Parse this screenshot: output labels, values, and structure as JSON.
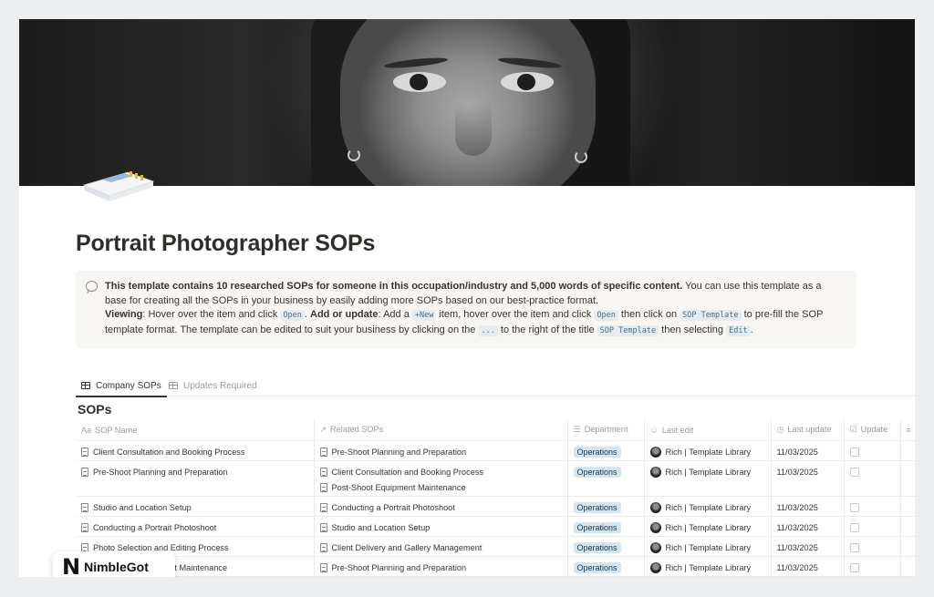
{
  "page": {
    "title": "Portrait Photographer SOPs"
  },
  "callout": {
    "bold_intro": "This template contains 10 researched SOPs for someone in this occupation/industry and 5,000 words of specific content.",
    "intro_rest": " You can use this template as a base for creating all the SOPs in your business by easily adding more SOPs based on our best-practice format.",
    "viewing_label": "Viewing",
    "viewing_text": ": Hover over the item and click ",
    "open_code": "Open",
    "period_sep": ". ",
    "add_label": "Add or update",
    "add_text_1": ": Add a ",
    "new_code": "+New",
    "add_text_2": " item, hover over the item and click ",
    "open_code_2": "Open",
    "add_text_3": " then click on ",
    "sop_template_code": "SOP Template",
    "add_text_4": " to pre-fill the SOP template format. The template can be edited to suit your business by clicking on the ",
    "dots_code": "...",
    "add_text_5": " to the right of the title ",
    "sop_template_code_2": "SOP Template",
    "add_text_6": " then selecting ",
    "edit_code": "Edit",
    "end": "."
  },
  "tabs": [
    {
      "label": "Company SOPs",
      "active": true
    },
    {
      "label": "Updates Required",
      "active": false
    }
  ],
  "database": {
    "title": "SOPs",
    "columns": {
      "name": "SOP Name",
      "related": "Related SOPs",
      "department": "Department",
      "last_edit": "Last edit",
      "last_update": "Last update",
      "update": "Update"
    },
    "column_icons": {
      "name": "Aa",
      "related": "↗",
      "department": "☰",
      "last_edit": "☺",
      "last_update": "◷",
      "update": "☑"
    },
    "rows": [
      {
        "name": "Client Consultation and Booking Process",
        "related": [
          "Pre-Shoot Planning and Preparation"
        ],
        "department": "Operations",
        "editor": "Rich | Template Library",
        "date": "11/03/2025"
      },
      {
        "name": "Pre-Shoot Planning and Preparation",
        "related": [
          "Client Consultation and Booking Process",
          "Post-Shoot Equipment Maintenance"
        ],
        "department": "Operations",
        "editor": "Rich | Template Library",
        "date": "11/03/2025"
      },
      {
        "name": "Studio and Location Setup",
        "related": [
          "Conducting a Portrait Photoshoot"
        ],
        "department": "Operations",
        "editor": "Rich | Template Library",
        "date": "11/03/2025"
      },
      {
        "name": "Conducting a Portrait Photoshoot",
        "related": [
          "Studio and Location Setup"
        ],
        "department": "Operations",
        "editor": "Rich | Template Library",
        "date": "11/03/2025"
      },
      {
        "name": "Photo Selection and Editing Process",
        "related": [
          "Client Delivery and Gallery Management"
        ],
        "department": "Operations",
        "editor": "Rich | Template Library",
        "date": "11/03/2025"
      },
      {
        "name": "Post-Shoot Equipment Maintenance",
        "related": [
          "Pre-Shoot Planning and Preparation"
        ],
        "department": "Operations",
        "editor": "Rich | Template Library",
        "date": "11/03/2025"
      }
    ]
  },
  "watermark": {
    "logo_glyph": "N",
    "text": "NimbleGot"
  },
  "colors": {
    "tag_bg": "#d3e5ef",
    "tag_text": "#183347",
    "callout_bg": "#f7f6f3"
  }
}
